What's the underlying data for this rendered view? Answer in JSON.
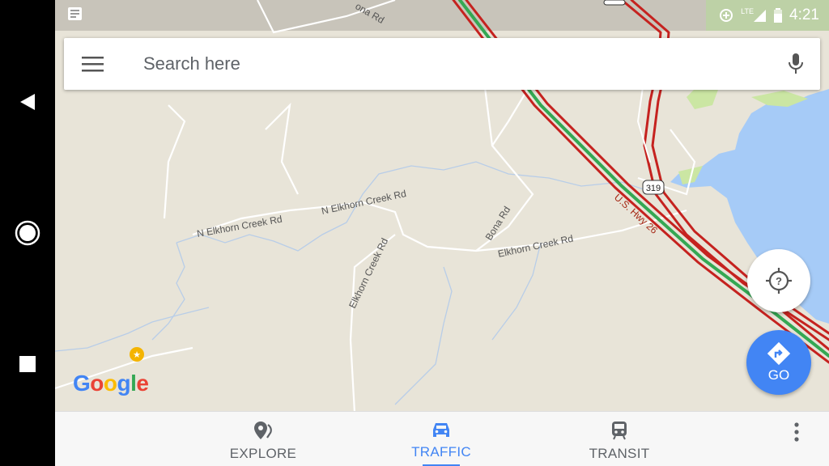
{
  "status": {
    "time": "4:21",
    "network": "LTE",
    "icons": [
      "data-saver-icon",
      "signal-icon",
      "battery-icon"
    ]
  },
  "search": {
    "placeholder": "Search here"
  },
  "map": {
    "road_labels": {
      "bona_top": "ona Rd",
      "n_elkhorn_1": "N Elkhorn Creek Rd",
      "n_elkhorn_2": "N Elkhorn Creek Rd",
      "bona": "Bona Rd",
      "elkhorn": "Elkhorn Creek Rd",
      "elkhorn_vertical": "Elkhorn Creek Rd",
      "hwy26": "U.S. Hwy 26",
      "shield_319": "319"
    },
    "logo": "Google",
    "go_label": "GO",
    "colors": {
      "land": "#e8e4d8",
      "water": "#a6cbf7",
      "park": "#cbe6a3",
      "traffic_red": "#c5221f",
      "traffic_green": "#34a853"
    }
  },
  "bottom_nav": {
    "tabs": [
      {
        "label": "EXPLORE",
        "icon": "explore-pin-icon",
        "active": false
      },
      {
        "label": "TRAFFIC",
        "icon": "car-icon",
        "active": true
      },
      {
        "label": "TRANSIT",
        "icon": "train-icon",
        "active": false
      }
    ]
  },
  "colors": {
    "accent": "#4285f4"
  }
}
